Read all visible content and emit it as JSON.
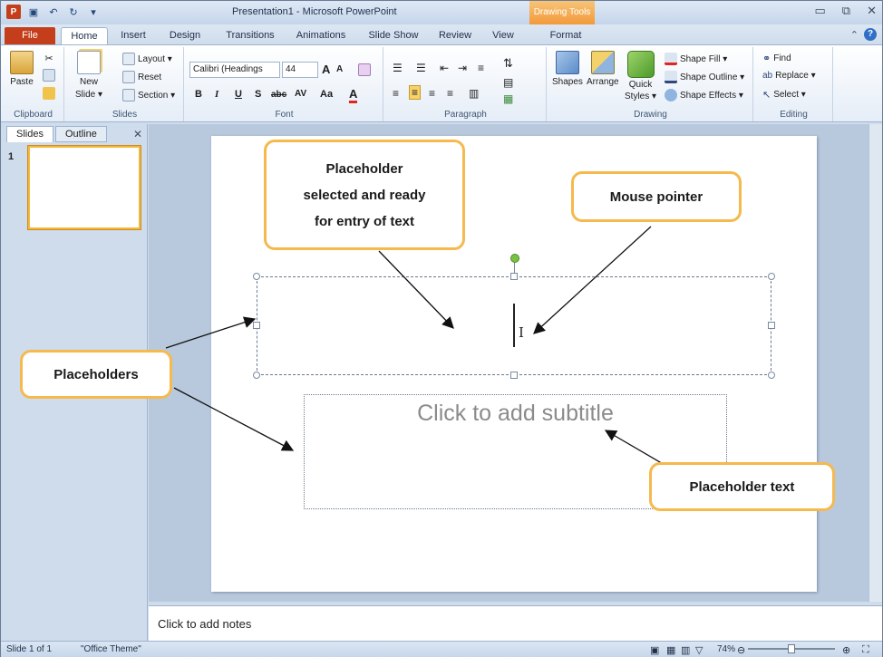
{
  "window": {
    "title": "Presentation1 - Microsoft PowerPoint",
    "context_tab": "Drawing Tools"
  },
  "tabs": [
    "File",
    "Home",
    "Insert",
    "Design",
    "Transitions",
    "Animations",
    "Slide Show",
    "Review",
    "View",
    "Format"
  ],
  "ribbon": {
    "clipboard": {
      "paste": "Paste",
      "label": "Clipboard"
    },
    "slides": {
      "new_slide_1": "New",
      "new_slide_2": "Slide ▾",
      "layout": "Layout ▾",
      "reset": "Reset",
      "section": "Section ▾",
      "label": "Slides"
    },
    "font": {
      "font_name": "Calibri (Headings",
      "font_size": "44",
      "grow": "A",
      "shrink": "A",
      "bold": "B",
      "italic": "I",
      "underline": "U",
      "shadow": "S",
      "strike": "abc",
      "spacing": "AV",
      "case": "Aa",
      "color": "A",
      "label": "Font"
    },
    "paragraph": {
      "label": "Paragraph"
    },
    "drawing": {
      "shapes": "Shapes",
      "arrange": "Arrange",
      "quick_styles_1": "Quick",
      "quick_styles_2": "Styles ▾",
      "shape_fill": "Shape Fill ▾",
      "shape_outline": "Shape Outline ▾",
      "shape_effects": "Shape Effects ▾",
      "label": "Drawing"
    },
    "editing": {
      "find": "Find",
      "replace": "Replace ▾",
      "select": "Select ▾",
      "label": "Editing"
    }
  },
  "panes": {
    "slides_tab": "Slides",
    "outline_tab": "Outline",
    "close": "✕",
    "thumb_number": "1"
  },
  "slide": {
    "subtitle_placeholder": "Click to add subtitle"
  },
  "notes": {
    "placeholder": "Click to add notes"
  },
  "status": {
    "slide_info": "Slide 1 of 1",
    "theme": "\"Office Theme\"",
    "zoom": "74%"
  },
  "callouts": {
    "selected_line1": "Placeholder",
    "selected_line2": "selected and ready",
    "selected_line3": "for entry of text",
    "mouse_pointer": "Mouse pointer",
    "placeholders": "Placeholders",
    "placeholder_text": "Placeholder text"
  },
  "colors": {
    "file_tab": "#c43e1c",
    "callout_border": "#f5b94d",
    "context_tab": "#f29a3a"
  }
}
